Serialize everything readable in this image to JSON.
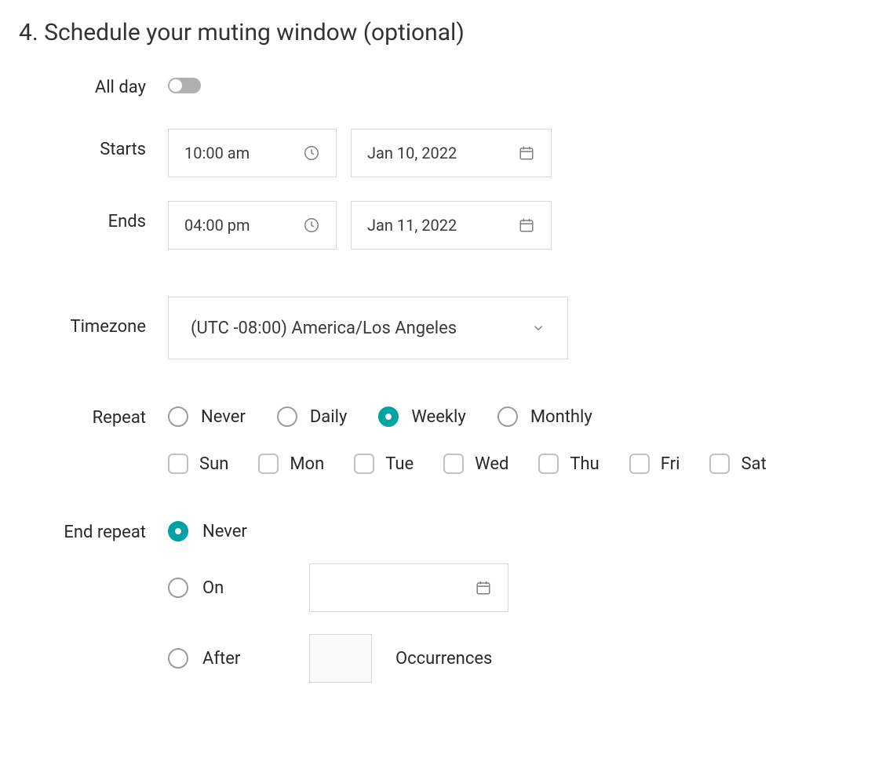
{
  "heading": "4. Schedule your muting window (optional)",
  "labels": {
    "all_day": "All day",
    "starts": "Starts",
    "ends": "Ends",
    "timezone": "Timezone",
    "repeat": "Repeat",
    "end_repeat": "End repeat"
  },
  "starts": {
    "time": "10:00 am",
    "date": "Jan 10, 2022"
  },
  "ends": {
    "time": "04:00 pm",
    "date": "Jan 11, 2022"
  },
  "timezone": {
    "value": "(UTC -08:00) America/Los Angeles"
  },
  "repeat": {
    "options": [
      "Never",
      "Daily",
      "Weekly",
      "Monthly"
    ],
    "selected": "Weekly",
    "days": [
      "Sun",
      "Mon",
      "Tue",
      "Wed",
      "Thu",
      "Fri",
      "Sat"
    ],
    "days_selected": []
  },
  "end_repeat_options": {
    "never": "Never",
    "on": "On",
    "after": "After",
    "occurrences_label": "Occurrences",
    "selected": "Never"
  }
}
